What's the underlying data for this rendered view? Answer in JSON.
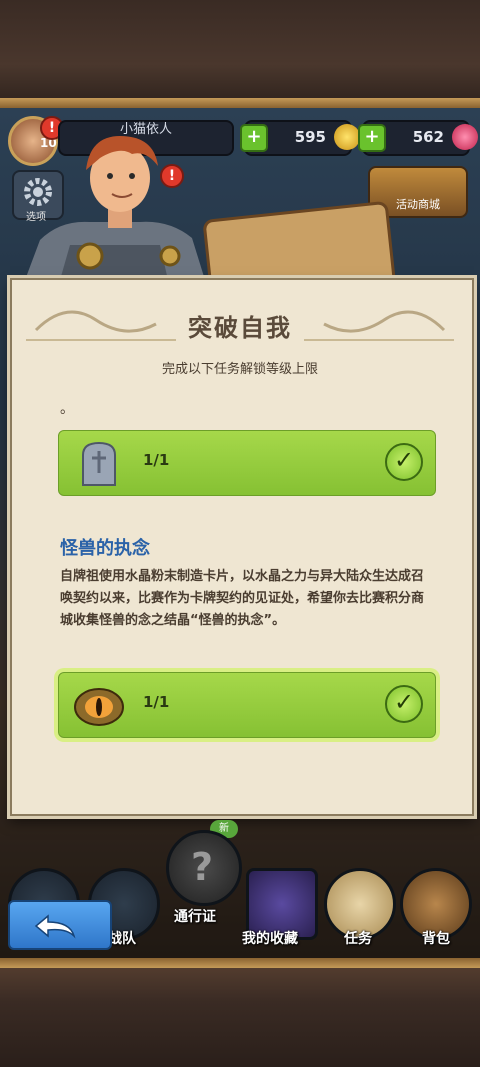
{
  "hud": {
    "player_name": "小猫依人",
    "level": "10",
    "alert": "!",
    "gold": "595",
    "gems": "562",
    "plus": "+"
  },
  "side": {
    "options_label": "选项",
    "shop_label": "活动商城"
  },
  "dialog": {
    "title": "突破自我",
    "subtitle": "完成以下任务解锁等级上限",
    "stray_text": "。",
    "tasks": [
      {
        "icon": "tombstone-icon",
        "count": "1/1"
      },
      {
        "icon": "monster-eye-icon",
        "count": "1/1"
      }
    ],
    "section_title": "怪兽的执念",
    "description": "自牌祖使用水晶粉末制造卡片，以水晶之力与异大陆众生达成召唤契约以来，比赛作为卡牌契约的见证处，希望你去比赛积分商城收集怪兽的念之结晶“怪兽的执念”。"
  },
  "nav": {
    "items": [
      "战队",
      "通行证",
      "我的收藏",
      "任务",
      "背包"
    ],
    "new_badge": "新",
    "question": "?"
  },
  "colors": {
    "task_green": "#96cd3e",
    "title_blue": "#2a62a8",
    "parchment": "#efe6d2"
  }
}
